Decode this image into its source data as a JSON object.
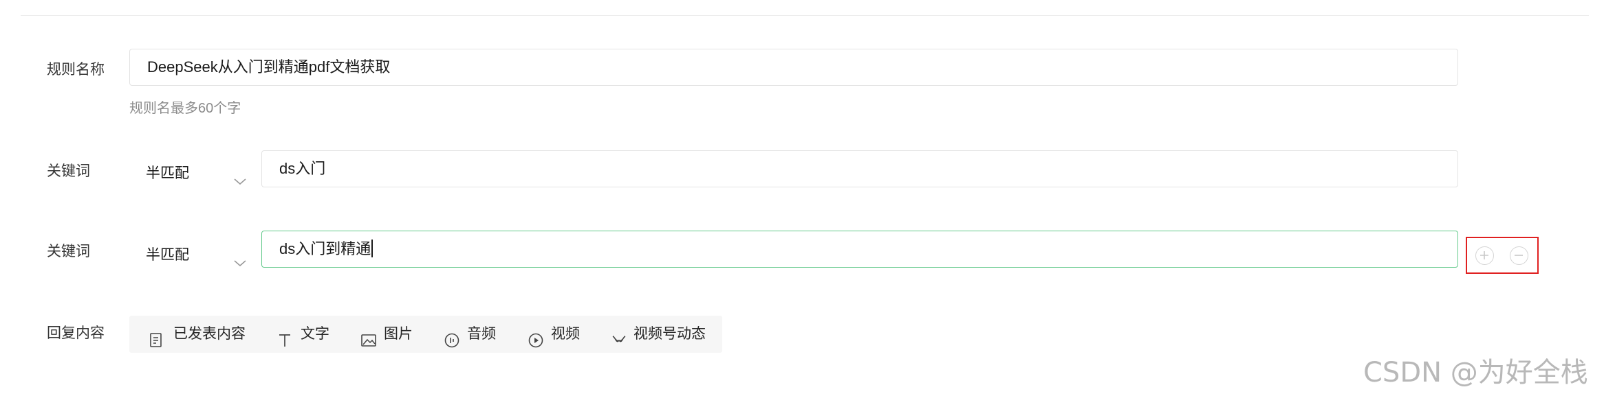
{
  "rule_name": {
    "label": "规则名称",
    "value": "DeepSeek从入门到精通pdf文档获取",
    "hint": "规则名最多60个字"
  },
  "keywords": [
    {
      "label": "关键词",
      "match_mode": "半匹配",
      "value": "ds入门"
    },
    {
      "label": "关键词",
      "match_mode": "半匹配",
      "value": "ds入门到精通"
    }
  ],
  "keyword_controls": {
    "add_icon": "plus-icon",
    "remove_icon": "minus-icon",
    "highlight_color": "#e02020"
  },
  "reply": {
    "label": "回复内容",
    "items": [
      {
        "label": "已发表内容",
        "icon": "document-icon"
      },
      {
        "label": "文字",
        "icon": "text-icon"
      },
      {
        "label": "图片",
        "icon": "image-icon"
      },
      {
        "label": "音频",
        "icon": "audio-icon"
      },
      {
        "label": "视频",
        "icon": "video-icon"
      },
      {
        "label": "视频号动态",
        "icon": "channels-icon"
      }
    ]
  },
  "focus_color": "#62c98a",
  "watermark": "CSDN @为好全栈"
}
